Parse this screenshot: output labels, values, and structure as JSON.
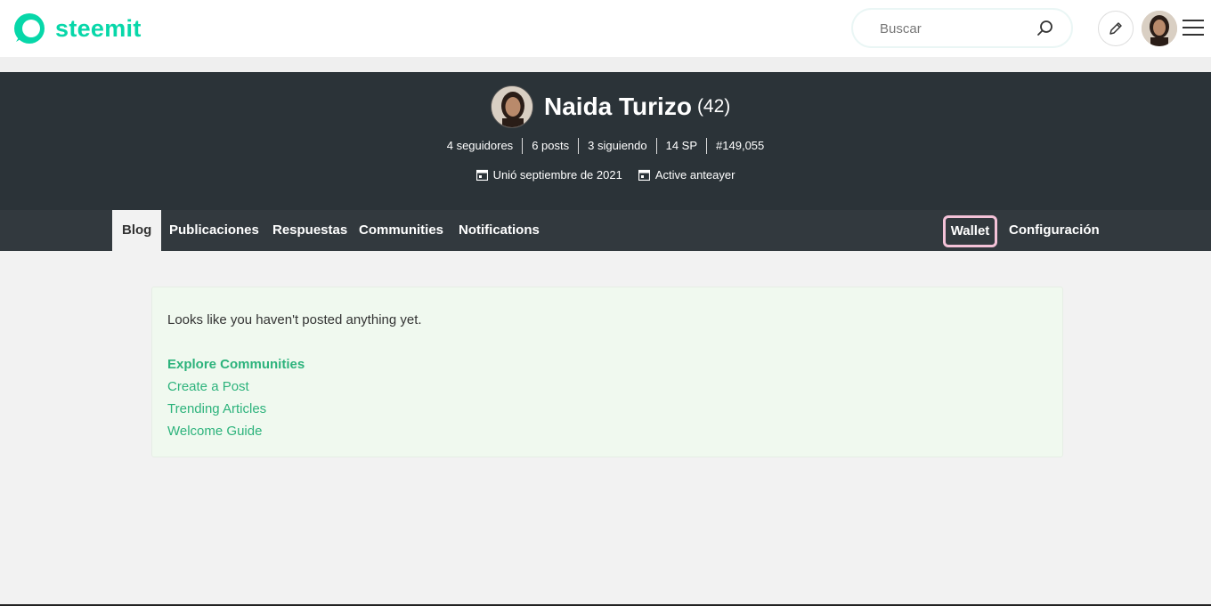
{
  "header": {
    "logo_text": "steemit",
    "brand_color": "#07d7a9",
    "search_placeholder": "Buscar",
    "icons": [
      "steemit-logo-icon",
      "search-icon",
      "pencil-icon",
      "hamburger-menu-icon"
    ]
  },
  "profile": {
    "name": "Naida Turizo",
    "reputation": "(42)",
    "stats": {
      "followers": "4 seguidores",
      "posts": "6 posts",
      "following": "3 siguiendo",
      "sp": "14 SP",
      "rank": "#149,055"
    },
    "joined": "Unió septiembre de 2021",
    "active": "Active anteayer"
  },
  "nav": {
    "tabs": [
      "Blog",
      "Publicaciones",
      "Respuestas",
      "Communities",
      "Notifications"
    ],
    "active_tab": "Blog",
    "wallet": "Wallet",
    "settings": "Configuración",
    "highlight_color": "#f4c2d8"
  },
  "content": {
    "empty_message": "Looks like you haven't posted anything yet.",
    "links": [
      "Explore Communities",
      "Create a Post",
      "Trending Articles",
      "Welcome Guide"
    ],
    "link_color": "#2db37c"
  }
}
